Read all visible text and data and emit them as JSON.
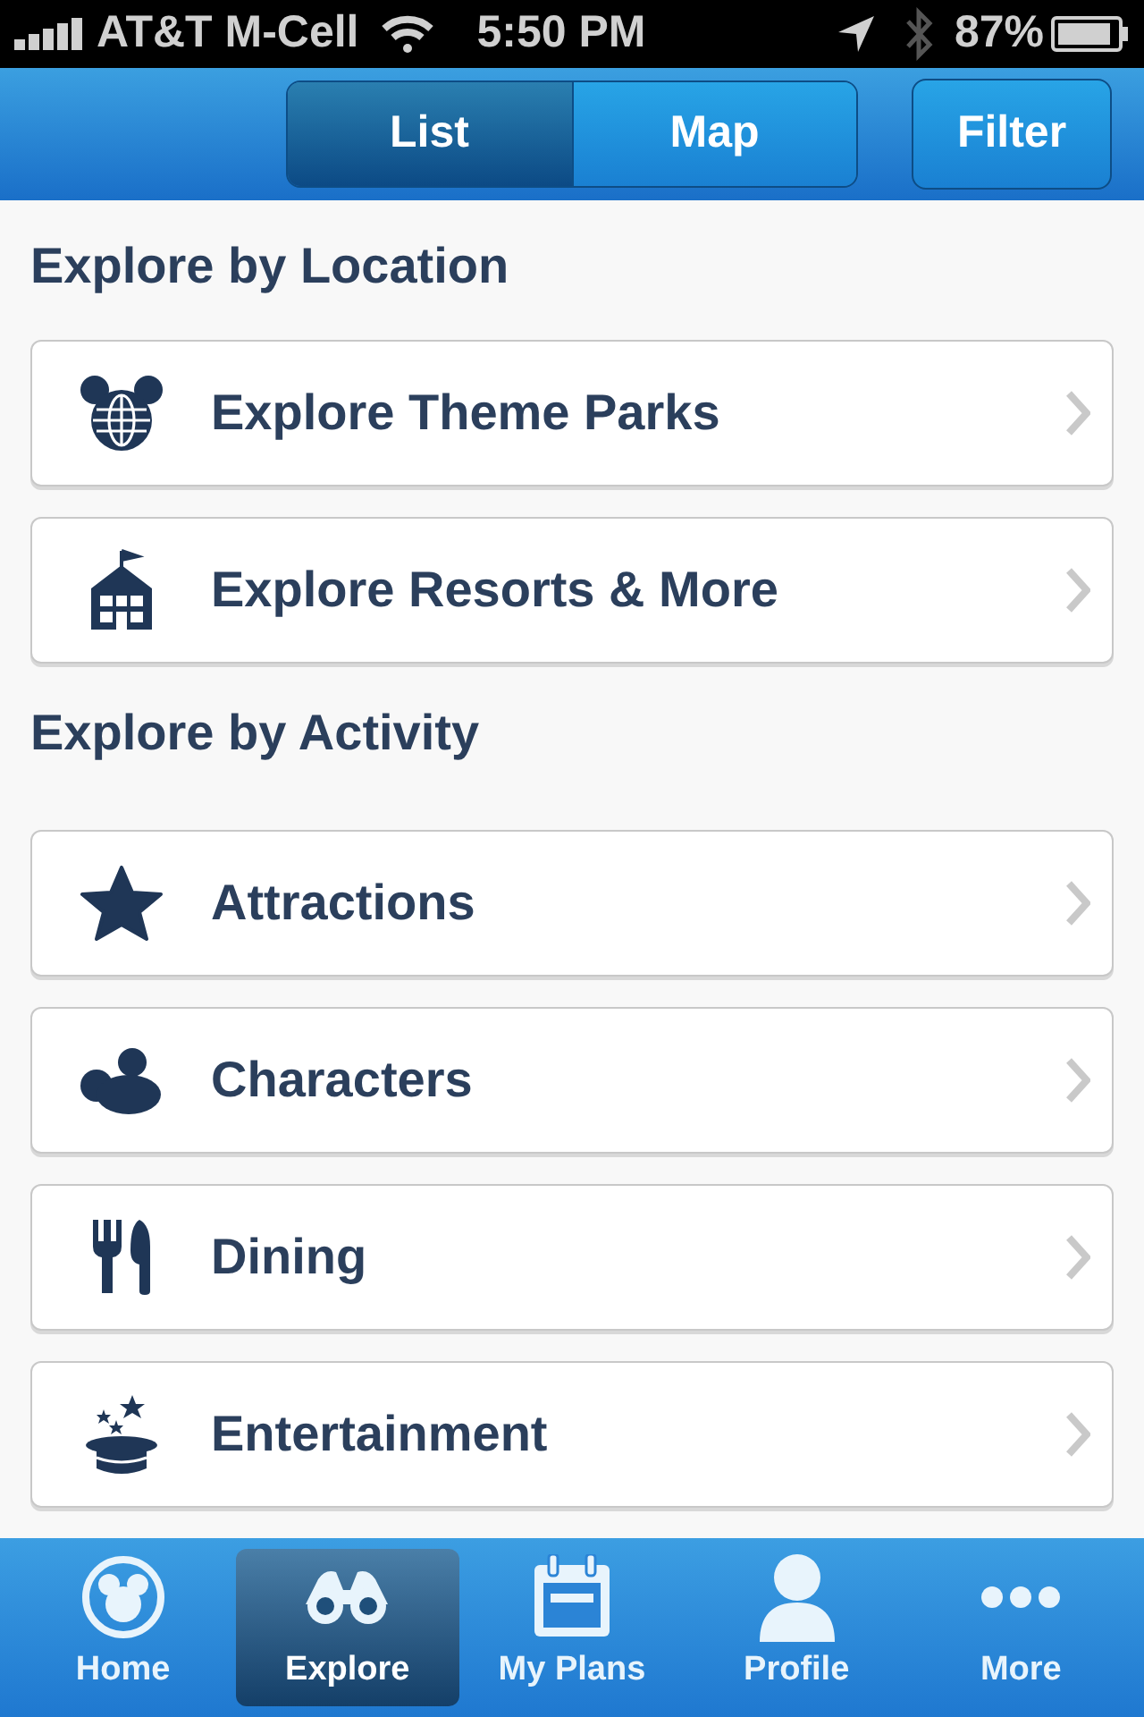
{
  "status_bar": {
    "carrier": "AT&T M-Cell",
    "time": "5:50 PM",
    "battery": "87%"
  },
  "header": {
    "view_toggle": [
      {
        "label": "List",
        "selected": true
      },
      {
        "label": "Map",
        "selected": false
      }
    ],
    "filter_button": "Filter"
  },
  "sections": [
    {
      "heading": "Explore by Location",
      "items": [
        {
          "kind": "parks",
          "label": "Explore Theme Parks"
        },
        {
          "kind": "resorts",
          "label": "Explore Resorts & More"
        }
      ]
    },
    {
      "heading": "Explore by Activity",
      "items": [
        {
          "kind": "attractions",
          "label": "Attractions"
        },
        {
          "kind": "characters",
          "label": "Characters"
        },
        {
          "kind": "dining",
          "label": "Dining"
        },
        {
          "kind": "entertainment",
          "label": "Entertainment"
        }
      ]
    }
  ],
  "tab_bar": [
    {
      "kind": "home",
      "label": "Home",
      "selected": false
    },
    {
      "kind": "explore",
      "label": "Explore",
      "selected": true
    },
    {
      "kind": "plans",
      "label": "My Plans",
      "selected": false
    },
    {
      "kind": "profile",
      "label": "Profile",
      "selected": false
    },
    {
      "kind": "more",
      "label": "More",
      "selected": false
    }
  ]
}
